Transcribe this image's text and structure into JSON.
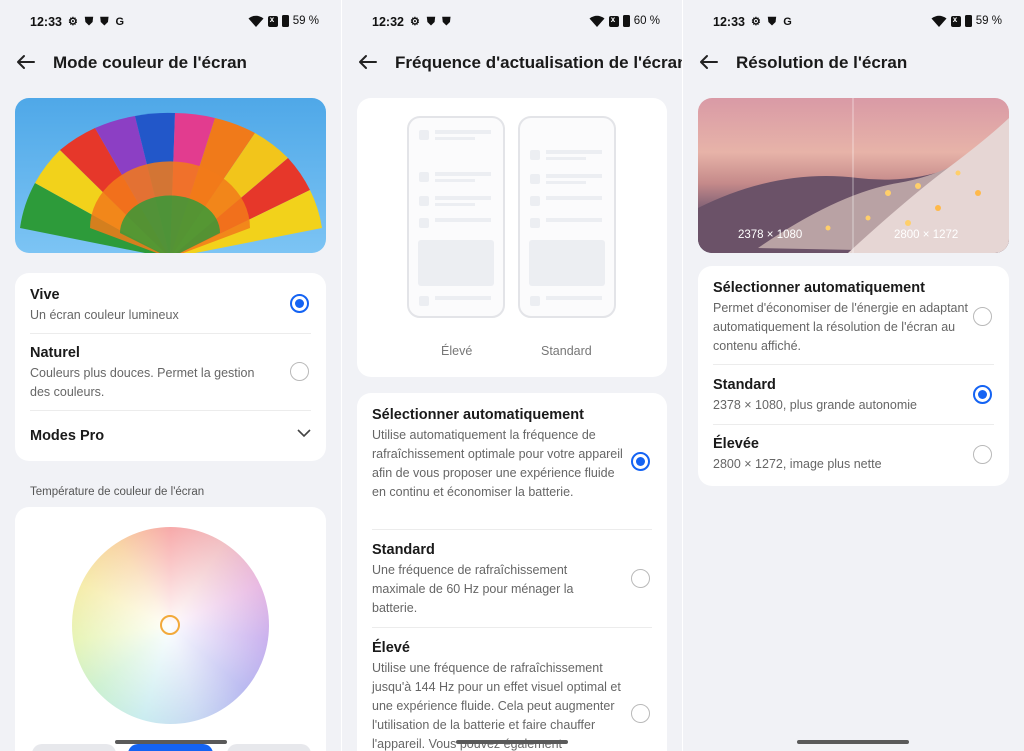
{
  "screens": [
    {
      "status": {
        "time": "12:33",
        "icons": "⚙ ⛊ ⛊ G",
        "battery": "59 %"
      },
      "title": "Mode couleur de l'écran",
      "options": [
        {
          "label": "Vive",
          "sub": "Un écran couleur lumineux",
          "selected": true
        },
        {
          "label": "Naturel",
          "sub": "Couleurs plus douces. Permet la gestion des couleurs.",
          "selected": false
        }
      ],
      "pro_modes": "Modes Pro",
      "temperature_label": "Température de couleur de l'écran"
    },
    {
      "status": {
        "time": "12:32",
        "icons": "⚙ ⛊ ⛊",
        "battery": "60 %"
      },
      "title": "Fréquence d'actualisation de l'écran",
      "preview_labels": [
        "Élevé",
        "Standard"
      ],
      "options": [
        {
          "label": "Sélectionner automatiquement",
          "sub": "Utilise automatiquement la fréquence de rafraîchissement optimale pour votre appareil afin de vous proposer une expérience fluide en continu et économiser la batterie.",
          "selected": true
        },
        {
          "label": "Standard",
          "sub": "Une fréquence de rafraîchissement maximale de 60 Hz pour ménager la batterie.",
          "selected": false
        },
        {
          "label": "Élevé",
          "sub": "Utilise une fréquence de rafraîchissement jusqu'à 144 Hz pour un effet visuel optimal et une expérience fluide. Cela peut augmenter l'utilisation de la batterie et faire chauffer l'appareil. Vous pouvez également",
          "selected": false
        }
      ]
    },
    {
      "status": {
        "time": "12:33",
        "icons": "⚙ ⛊ G",
        "battery": "59 %"
      },
      "title": "Résolution de l'écran",
      "image_labels": [
        "2378 × 1080",
        "2800 × 1272"
      ],
      "options": [
        {
          "label": "Sélectionner automatiquement",
          "sub": "Permet d'économiser de l'énergie en adaptant automatiquement la résolution de l'écran au contenu affiché.",
          "selected": false
        },
        {
          "label": "Standard",
          "sub": "2378 × 1080, plus grande autonomie",
          "selected": true
        },
        {
          "label": "Élevée",
          "sub": "2800 × 1272, image plus nette",
          "selected": false
        }
      ]
    }
  ],
  "colors": {
    "accent": "#1463f3",
    "background": "#f1f2f6"
  }
}
